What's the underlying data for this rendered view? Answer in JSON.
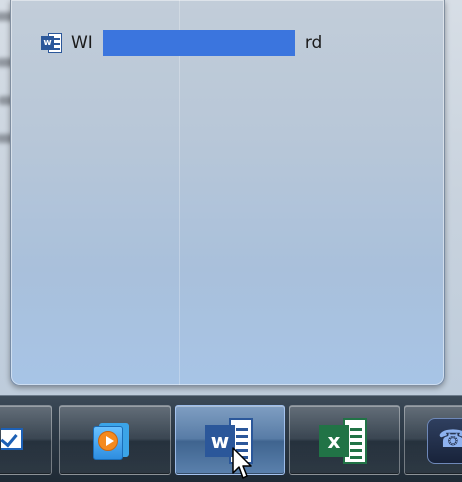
{
  "preview": {
    "title_start": "WI",
    "title_end": "rd",
    "word_badge": "w"
  },
  "taskbar": {
    "items": [
      {
        "name": "outlook",
        "icon": "check-mail-icon",
        "active": false
      },
      {
        "name": "media-player",
        "icon": "media-player-icon",
        "active": false
      },
      {
        "name": "word",
        "icon": "word-icon",
        "badge": "w",
        "active": true
      },
      {
        "name": "excel",
        "icon": "excel-icon",
        "badge": "x",
        "active": false
      },
      {
        "name": "lync",
        "icon": "phone-icon",
        "active": false
      }
    ]
  },
  "colors": {
    "word": "#2b579a",
    "excel": "#217346",
    "redaction": "#3b75de",
    "taskbar": "#2b3845"
  }
}
